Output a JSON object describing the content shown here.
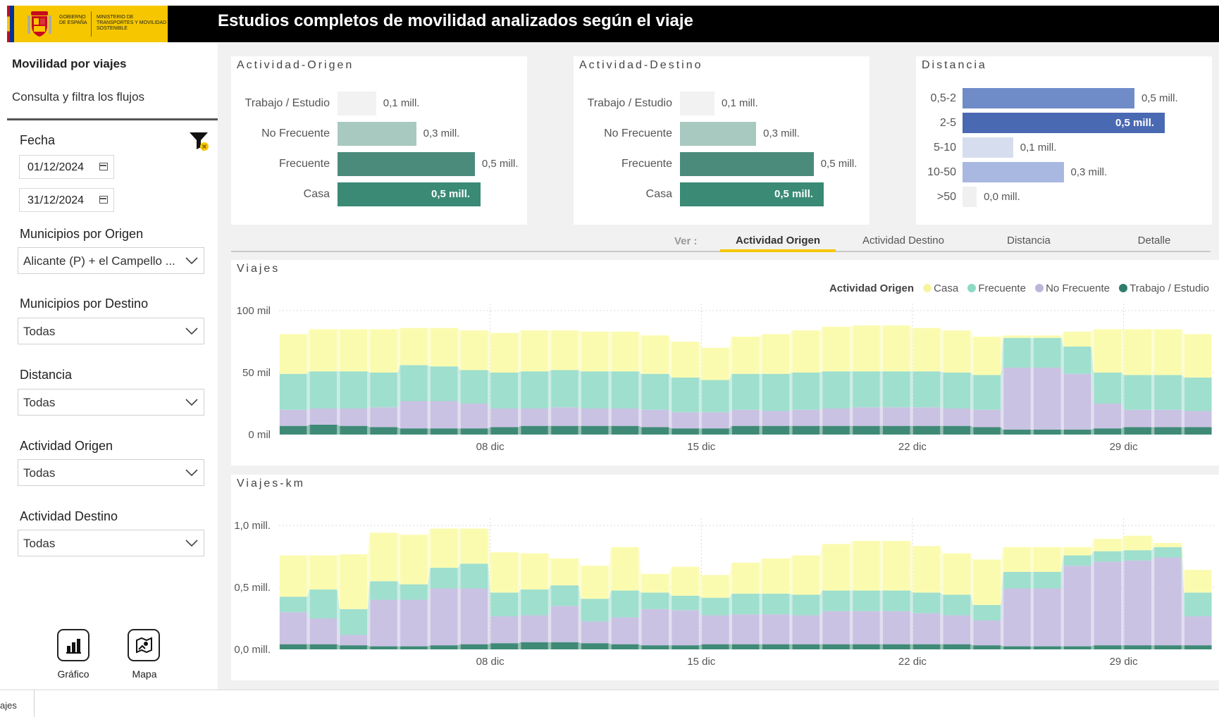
{
  "header": {
    "title": "Estudios completos de movilidad analizados según el viaje",
    "logo_gov": "GOBIERNO DE ESPAÑA",
    "logo_ministry": "MINISTERIO DE TRANSPORTES Y MOVILIDAD SOSTENIBLE"
  },
  "sidebar": {
    "title": "Movilidad por viajes",
    "subtitle": "Consulta y filtra los flujos",
    "fecha_label": "Fecha",
    "date_from": "01/12/2024",
    "date_to": "31/12/2024",
    "filters": [
      {
        "label": "Municipios por Origen",
        "value": "Alicante (P) + el Campello ..."
      },
      {
        "label": "Municipios por Destino",
        "value": "Todas"
      },
      {
        "label": "Distancia",
        "value": "Todas"
      },
      {
        "label": "Actividad Origen",
        "value": "Todas"
      },
      {
        "label": "Actividad Destino",
        "value": "Todas"
      }
    ],
    "nav": [
      {
        "label": "Gráfico"
      },
      {
        "label": "Mapa"
      }
    ]
  },
  "cards": {
    "origen": {
      "title": "Actividad-Origen",
      "rows": [
        {
          "label": "Trabajo / Estudio",
          "value": "0,1 mill.",
          "fraction": 0.27,
          "color": "#f2f2f2"
        },
        {
          "label": "No Frecuente",
          "value": "0,3 mill.",
          "fraction": 0.55,
          "color": "#a8c9c0"
        },
        {
          "label": "Frecuente",
          "value": "0,5 mill.",
          "fraction": 0.96,
          "color": "#4a8b7c"
        },
        {
          "label": "Casa",
          "value": "0,5 mill.",
          "fraction": 1.0,
          "color": "#3a8a75",
          "inside": true
        }
      ]
    },
    "destino": {
      "title": "Actividad-Destino",
      "rows": [
        {
          "label": "Trabajo / Estudio",
          "value": "0,1 mill.",
          "fraction": 0.24,
          "color": "#f2f2f2"
        },
        {
          "label": "No Frecuente",
          "value": "0,3 mill.",
          "fraction": 0.53,
          "color": "#a8c9c0"
        },
        {
          "label": "Frecuente",
          "value": "0,5 mill.",
          "fraction": 0.93,
          "color": "#4a8b7c"
        },
        {
          "label": "Casa",
          "value": "0,5 mill.",
          "fraction": 1.0,
          "color": "#3a8a75",
          "inside": true
        }
      ]
    },
    "distancia": {
      "title": "Distancia",
      "rows": [
        {
          "label": "0,5-2",
          "value": "0,5 mill.",
          "fraction": 0.85,
          "color": "#6f8cc8"
        },
        {
          "label": "2-5",
          "value": "0,5 mill.",
          "fraction": 1.0,
          "color": "#4a69b3",
          "inside": true
        },
        {
          "label": "5-10",
          "value": "0,1 mill.",
          "fraction": 0.25,
          "color": "#d6ddee"
        },
        {
          "label": "10-50",
          "value": "0,3 mill.",
          "fraction": 0.5,
          "color": "#a9b8e0"
        },
        {
          "label": ">50",
          "value": "0,0 mill.",
          "fraction": 0.07,
          "color": "#f0f0f0"
        }
      ]
    }
  },
  "tabs": {
    "ver": "Ver :",
    "items": [
      "Actividad Origen",
      "Actividad Destino",
      "Distancia",
      "Detalle"
    ],
    "active": 0
  },
  "legend": {
    "title": "Actividad Origen",
    "items": [
      {
        "label": "Casa",
        "color": "#f5f5a0"
      },
      {
        "label": "Frecuente",
        "color": "#8fd9c4"
      },
      {
        "label": "No Frecuente",
        "color": "#bdb6dc"
      },
      {
        "label": "Trabajo / Estudio",
        "color": "#2e7d6a"
      }
    ]
  },
  "colors": {
    "casa": "#fbfbb0",
    "frecuente": "#9edfcd",
    "nofrecuente": "#c9c2e3",
    "trabajo": "#3f8a77"
  },
  "chart_data": [
    {
      "type": "area",
      "title": "Viajes",
      "x_ticks": [
        "08 dic",
        "15 dic",
        "22 dic",
        "29 dic"
      ],
      "y_ticks": [
        "0 mil",
        "50 mil",
        "100 mil"
      ],
      "ylim": [
        0,
        100000
      ],
      "x": [
        "01/12",
        "02/12",
        "03/12",
        "04/12",
        "05/12",
        "06/12",
        "07/12",
        "08/12",
        "09/12",
        "10/12",
        "11/12",
        "12/12",
        "13/12",
        "14/12",
        "15/12",
        "16/12",
        "17/12",
        "18/12",
        "19/12",
        "20/12",
        "21/12",
        "22/12",
        "23/12",
        "24/12",
        "25/12",
        "26/12",
        "27/12",
        "28/12",
        "29/12",
        "30/12",
        "31/12"
      ],
      "series": [
        {
          "name": "Trabajo / Estudio",
          "values": [
            7000,
            8000,
            7000,
            6000,
            5000,
            5000,
            5000,
            6000,
            7000,
            7000,
            7000,
            7000,
            6000,
            5000,
            5000,
            7000,
            7000,
            7000,
            7000,
            7000,
            7000,
            7000,
            7000,
            6000,
            4000,
            4000,
            4000,
            5000,
            6000,
            6000,
            6000
          ]
        },
        {
          "name": "No Frecuente",
          "values": [
            13000,
            13000,
            14000,
            16000,
            22000,
            22000,
            20000,
            15000,
            14000,
            15000,
            14000,
            14000,
            14000,
            13000,
            13000,
            13000,
            12000,
            13000,
            14000,
            15000,
            15000,
            15000,
            14000,
            14000,
            50000,
            50000,
            45000,
            20000,
            14000,
            14000,
            13000
          ]
        },
        {
          "name": "Frecuente",
          "values": [
            29000,
            30000,
            30000,
            28000,
            29000,
            28000,
            27000,
            29000,
            30000,
            30000,
            30000,
            30000,
            29000,
            28000,
            26000,
            29000,
            30000,
            30000,
            30000,
            29000,
            29000,
            29000,
            29000,
            28000,
            24000,
            24000,
            22000,
            25000,
            28000,
            28000,
            27000
          ]
        },
        {
          "name": "Casa",
          "values": [
            32000,
            34000,
            34000,
            35000,
            30000,
            31000,
            32000,
            32000,
            33000,
            32000,
            32000,
            32000,
            31000,
            29000,
            26000,
            30000,
            32000,
            34000,
            36000,
            37000,
            37000,
            35000,
            34000,
            31000,
            2000,
            2000,
            12000,
            35000,
            37000,
            37000,
            35000
          ]
        }
      ]
    },
    {
      "type": "area",
      "title": "Viajes-km",
      "x_ticks": [
        "08 dic",
        "15 dic",
        "22 dic",
        "29 dic"
      ],
      "y_ticks": [
        "0,0 mill.",
        "0,5 mill.",
        "1,0 mill."
      ],
      "ylim": [
        0,
        1200000
      ],
      "x": [
        "01/12",
        "02/12",
        "03/12",
        "04/12",
        "05/12",
        "06/12",
        "07/12",
        "08/12",
        "09/12",
        "10/12",
        "11/12",
        "12/12",
        "13/12",
        "14/12",
        "15/12",
        "16/12",
        "17/12",
        "18/12",
        "19/12",
        "20/12",
        "21/12",
        "22/12",
        "23/12",
        "24/12",
        "25/12",
        "26/12",
        "27/12",
        "28/12",
        "29/12",
        "30/12",
        "31/12"
      ],
      "series": [
        {
          "name": "Trabajo / Estudio",
          "values": [
            50000,
            50000,
            40000,
            30000,
            30000,
            40000,
            50000,
            60000,
            70000,
            70000,
            60000,
            50000,
            40000,
            40000,
            50000,
            50000,
            50000,
            50000,
            50000,
            50000,
            50000,
            50000,
            50000,
            40000,
            30000,
            30000,
            30000,
            40000,
            40000,
            40000,
            40000
          ]
        },
        {
          "name": "No Frecuente",
          "values": [
            310000,
            250000,
            100000,
            450000,
            450000,
            550000,
            540000,
            260000,
            260000,
            350000,
            210000,
            260000,
            350000,
            340000,
            280000,
            290000,
            290000,
            280000,
            320000,
            320000,
            320000,
            300000,
            280000,
            240000,
            560000,
            560000,
            780000,
            810000,
            820000,
            850000,
            280000
          ]
        },
        {
          "name": "Frecuente",
          "values": [
            150000,
            280000,
            250000,
            180000,
            150000,
            200000,
            240000,
            230000,
            250000,
            200000,
            220000,
            260000,
            160000,
            140000,
            170000,
            200000,
            200000,
            200000,
            200000,
            200000,
            200000,
            200000,
            200000,
            150000,
            160000,
            160000,
            100000,
            100000,
            100000,
            100000,
            230000
          ]
        },
        {
          "name": "Casa",
          "values": [
            400000,
            330000,
            530000,
            470000,
            480000,
            380000,
            340000,
            390000,
            350000,
            260000,
            320000,
            420000,
            180000,
            280000,
            220000,
            300000,
            340000,
            380000,
            450000,
            480000,
            480000,
            450000,
            400000,
            440000,
            240000,
            240000,
            80000,
            120000,
            140000,
            40000,
            220000
          ]
        }
      ]
    }
  ]
}
